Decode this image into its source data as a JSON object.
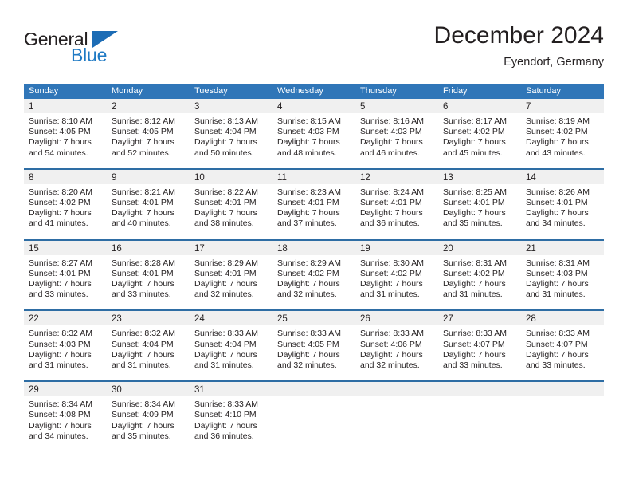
{
  "brand": {
    "name_part1": "General",
    "name_part2": "Blue",
    "triangle_icon": "blue-triangle-logo-mark",
    "accent_color": "#1c6cb5"
  },
  "header": {
    "title": "December 2024",
    "subtitle": "Eyendorf, Germany"
  },
  "theme": {
    "header_blue": "#3076b8",
    "separator_blue": "#2e6da4",
    "daynum_band_gray": "#f0f0f0",
    "text_color": "#231f20"
  },
  "weekdays": [
    "Sunday",
    "Monday",
    "Tuesday",
    "Wednesday",
    "Thursday",
    "Friday",
    "Saturday"
  ],
  "weeks": [
    [
      {
        "day": "1",
        "sunrise": "Sunrise: 8:10 AM",
        "sunset": "Sunset: 4:05 PM",
        "daylight1": "Daylight: 7 hours",
        "daylight2": "and 54 minutes."
      },
      {
        "day": "2",
        "sunrise": "Sunrise: 8:12 AM",
        "sunset": "Sunset: 4:05 PM",
        "daylight1": "Daylight: 7 hours",
        "daylight2": "and 52 minutes."
      },
      {
        "day": "3",
        "sunrise": "Sunrise: 8:13 AM",
        "sunset": "Sunset: 4:04 PM",
        "daylight1": "Daylight: 7 hours",
        "daylight2": "and 50 minutes."
      },
      {
        "day": "4",
        "sunrise": "Sunrise: 8:15 AM",
        "sunset": "Sunset: 4:03 PM",
        "daylight1": "Daylight: 7 hours",
        "daylight2": "and 48 minutes."
      },
      {
        "day": "5",
        "sunrise": "Sunrise: 8:16 AM",
        "sunset": "Sunset: 4:03 PM",
        "daylight1": "Daylight: 7 hours",
        "daylight2": "and 46 minutes."
      },
      {
        "day": "6",
        "sunrise": "Sunrise: 8:17 AM",
        "sunset": "Sunset: 4:02 PM",
        "daylight1": "Daylight: 7 hours",
        "daylight2": "and 45 minutes."
      },
      {
        "day": "7",
        "sunrise": "Sunrise: 8:19 AM",
        "sunset": "Sunset: 4:02 PM",
        "daylight1": "Daylight: 7 hours",
        "daylight2": "and 43 minutes."
      }
    ],
    [
      {
        "day": "8",
        "sunrise": "Sunrise: 8:20 AM",
        "sunset": "Sunset: 4:02 PM",
        "daylight1": "Daylight: 7 hours",
        "daylight2": "and 41 minutes."
      },
      {
        "day": "9",
        "sunrise": "Sunrise: 8:21 AM",
        "sunset": "Sunset: 4:01 PM",
        "daylight1": "Daylight: 7 hours",
        "daylight2": "and 40 minutes."
      },
      {
        "day": "10",
        "sunrise": "Sunrise: 8:22 AM",
        "sunset": "Sunset: 4:01 PM",
        "daylight1": "Daylight: 7 hours",
        "daylight2": "and 38 minutes."
      },
      {
        "day": "11",
        "sunrise": "Sunrise: 8:23 AM",
        "sunset": "Sunset: 4:01 PM",
        "daylight1": "Daylight: 7 hours",
        "daylight2": "and 37 minutes."
      },
      {
        "day": "12",
        "sunrise": "Sunrise: 8:24 AM",
        "sunset": "Sunset: 4:01 PM",
        "daylight1": "Daylight: 7 hours",
        "daylight2": "and 36 minutes."
      },
      {
        "day": "13",
        "sunrise": "Sunrise: 8:25 AM",
        "sunset": "Sunset: 4:01 PM",
        "daylight1": "Daylight: 7 hours",
        "daylight2": "and 35 minutes."
      },
      {
        "day": "14",
        "sunrise": "Sunrise: 8:26 AM",
        "sunset": "Sunset: 4:01 PM",
        "daylight1": "Daylight: 7 hours",
        "daylight2": "and 34 minutes."
      }
    ],
    [
      {
        "day": "15",
        "sunrise": "Sunrise: 8:27 AM",
        "sunset": "Sunset: 4:01 PM",
        "daylight1": "Daylight: 7 hours",
        "daylight2": "and 33 minutes."
      },
      {
        "day": "16",
        "sunrise": "Sunrise: 8:28 AM",
        "sunset": "Sunset: 4:01 PM",
        "daylight1": "Daylight: 7 hours",
        "daylight2": "and 33 minutes."
      },
      {
        "day": "17",
        "sunrise": "Sunrise: 8:29 AM",
        "sunset": "Sunset: 4:01 PM",
        "daylight1": "Daylight: 7 hours",
        "daylight2": "and 32 minutes."
      },
      {
        "day": "18",
        "sunrise": "Sunrise: 8:29 AM",
        "sunset": "Sunset: 4:02 PM",
        "daylight1": "Daylight: 7 hours",
        "daylight2": "and 32 minutes."
      },
      {
        "day": "19",
        "sunrise": "Sunrise: 8:30 AM",
        "sunset": "Sunset: 4:02 PM",
        "daylight1": "Daylight: 7 hours",
        "daylight2": "and 31 minutes."
      },
      {
        "day": "20",
        "sunrise": "Sunrise: 8:31 AM",
        "sunset": "Sunset: 4:02 PM",
        "daylight1": "Daylight: 7 hours",
        "daylight2": "and 31 minutes."
      },
      {
        "day": "21",
        "sunrise": "Sunrise: 8:31 AM",
        "sunset": "Sunset: 4:03 PM",
        "daylight1": "Daylight: 7 hours",
        "daylight2": "and 31 minutes."
      }
    ],
    [
      {
        "day": "22",
        "sunrise": "Sunrise: 8:32 AM",
        "sunset": "Sunset: 4:03 PM",
        "daylight1": "Daylight: 7 hours",
        "daylight2": "and 31 minutes."
      },
      {
        "day": "23",
        "sunrise": "Sunrise: 8:32 AM",
        "sunset": "Sunset: 4:04 PM",
        "daylight1": "Daylight: 7 hours",
        "daylight2": "and 31 minutes."
      },
      {
        "day": "24",
        "sunrise": "Sunrise: 8:33 AM",
        "sunset": "Sunset: 4:04 PM",
        "daylight1": "Daylight: 7 hours",
        "daylight2": "and 31 minutes."
      },
      {
        "day": "25",
        "sunrise": "Sunrise: 8:33 AM",
        "sunset": "Sunset: 4:05 PM",
        "daylight1": "Daylight: 7 hours",
        "daylight2": "and 32 minutes."
      },
      {
        "day": "26",
        "sunrise": "Sunrise: 8:33 AM",
        "sunset": "Sunset: 4:06 PM",
        "daylight1": "Daylight: 7 hours",
        "daylight2": "and 32 minutes."
      },
      {
        "day": "27",
        "sunrise": "Sunrise: 8:33 AM",
        "sunset": "Sunset: 4:07 PM",
        "daylight1": "Daylight: 7 hours",
        "daylight2": "and 33 minutes."
      },
      {
        "day": "28",
        "sunrise": "Sunrise: 8:33 AM",
        "sunset": "Sunset: 4:07 PM",
        "daylight1": "Daylight: 7 hours",
        "daylight2": "and 33 minutes."
      }
    ],
    [
      {
        "day": "29",
        "sunrise": "Sunrise: 8:34 AM",
        "sunset": "Sunset: 4:08 PM",
        "daylight1": "Daylight: 7 hours",
        "daylight2": "and 34 minutes."
      },
      {
        "day": "30",
        "sunrise": "Sunrise: 8:34 AM",
        "sunset": "Sunset: 4:09 PM",
        "daylight1": "Daylight: 7 hours",
        "daylight2": "and 35 minutes."
      },
      {
        "day": "31",
        "sunrise": "Sunrise: 8:33 AM",
        "sunset": "Sunset: 4:10 PM",
        "daylight1": "Daylight: 7 hours",
        "daylight2": "and 36 minutes."
      },
      {
        "day": "",
        "sunrise": "",
        "sunset": "",
        "daylight1": "",
        "daylight2": ""
      },
      {
        "day": "",
        "sunrise": "",
        "sunset": "",
        "daylight1": "",
        "daylight2": ""
      },
      {
        "day": "",
        "sunrise": "",
        "sunset": "",
        "daylight1": "",
        "daylight2": ""
      },
      {
        "day": "",
        "sunrise": "",
        "sunset": "",
        "daylight1": "",
        "daylight2": ""
      }
    ]
  ]
}
